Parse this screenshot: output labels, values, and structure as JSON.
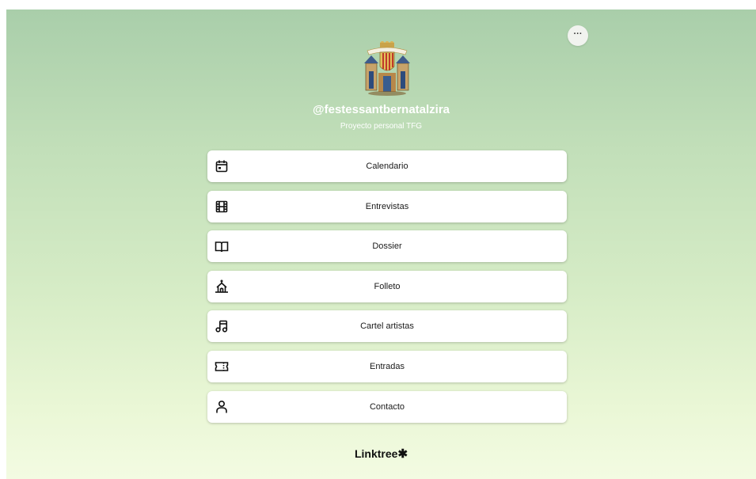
{
  "header": {
    "more_label": "···",
    "avatar_icon": "coat-of-arms-icon",
    "username": "@festessantbernatalzira",
    "subtitle": "Proyecto personal TFG"
  },
  "links": [
    {
      "label": "Calendario",
      "icon": "calendar-icon"
    },
    {
      "label": "Entrevistas",
      "icon": "film-icon"
    },
    {
      "label": "Dossier",
      "icon": "open-book-icon"
    },
    {
      "label": "Folleto",
      "icon": "church-icon"
    },
    {
      "label": "Cartel artistas",
      "icon": "music-note-icon"
    },
    {
      "label": "Entradas",
      "icon": "ticket-icon"
    },
    {
      "label": "Contacto",
      "icon": "person-icon"
    }
  ],
  "footer": {
    "brand": "Linktree",
    "brand_symbol": "✱"
  },
  "colors": {
    "background_top": "#a9ceaa",
    "background_bottom": "#f3fbe2",
    "button_background": "#ffffff",
    "text_dark": "#1a1a1a"
  }
}
